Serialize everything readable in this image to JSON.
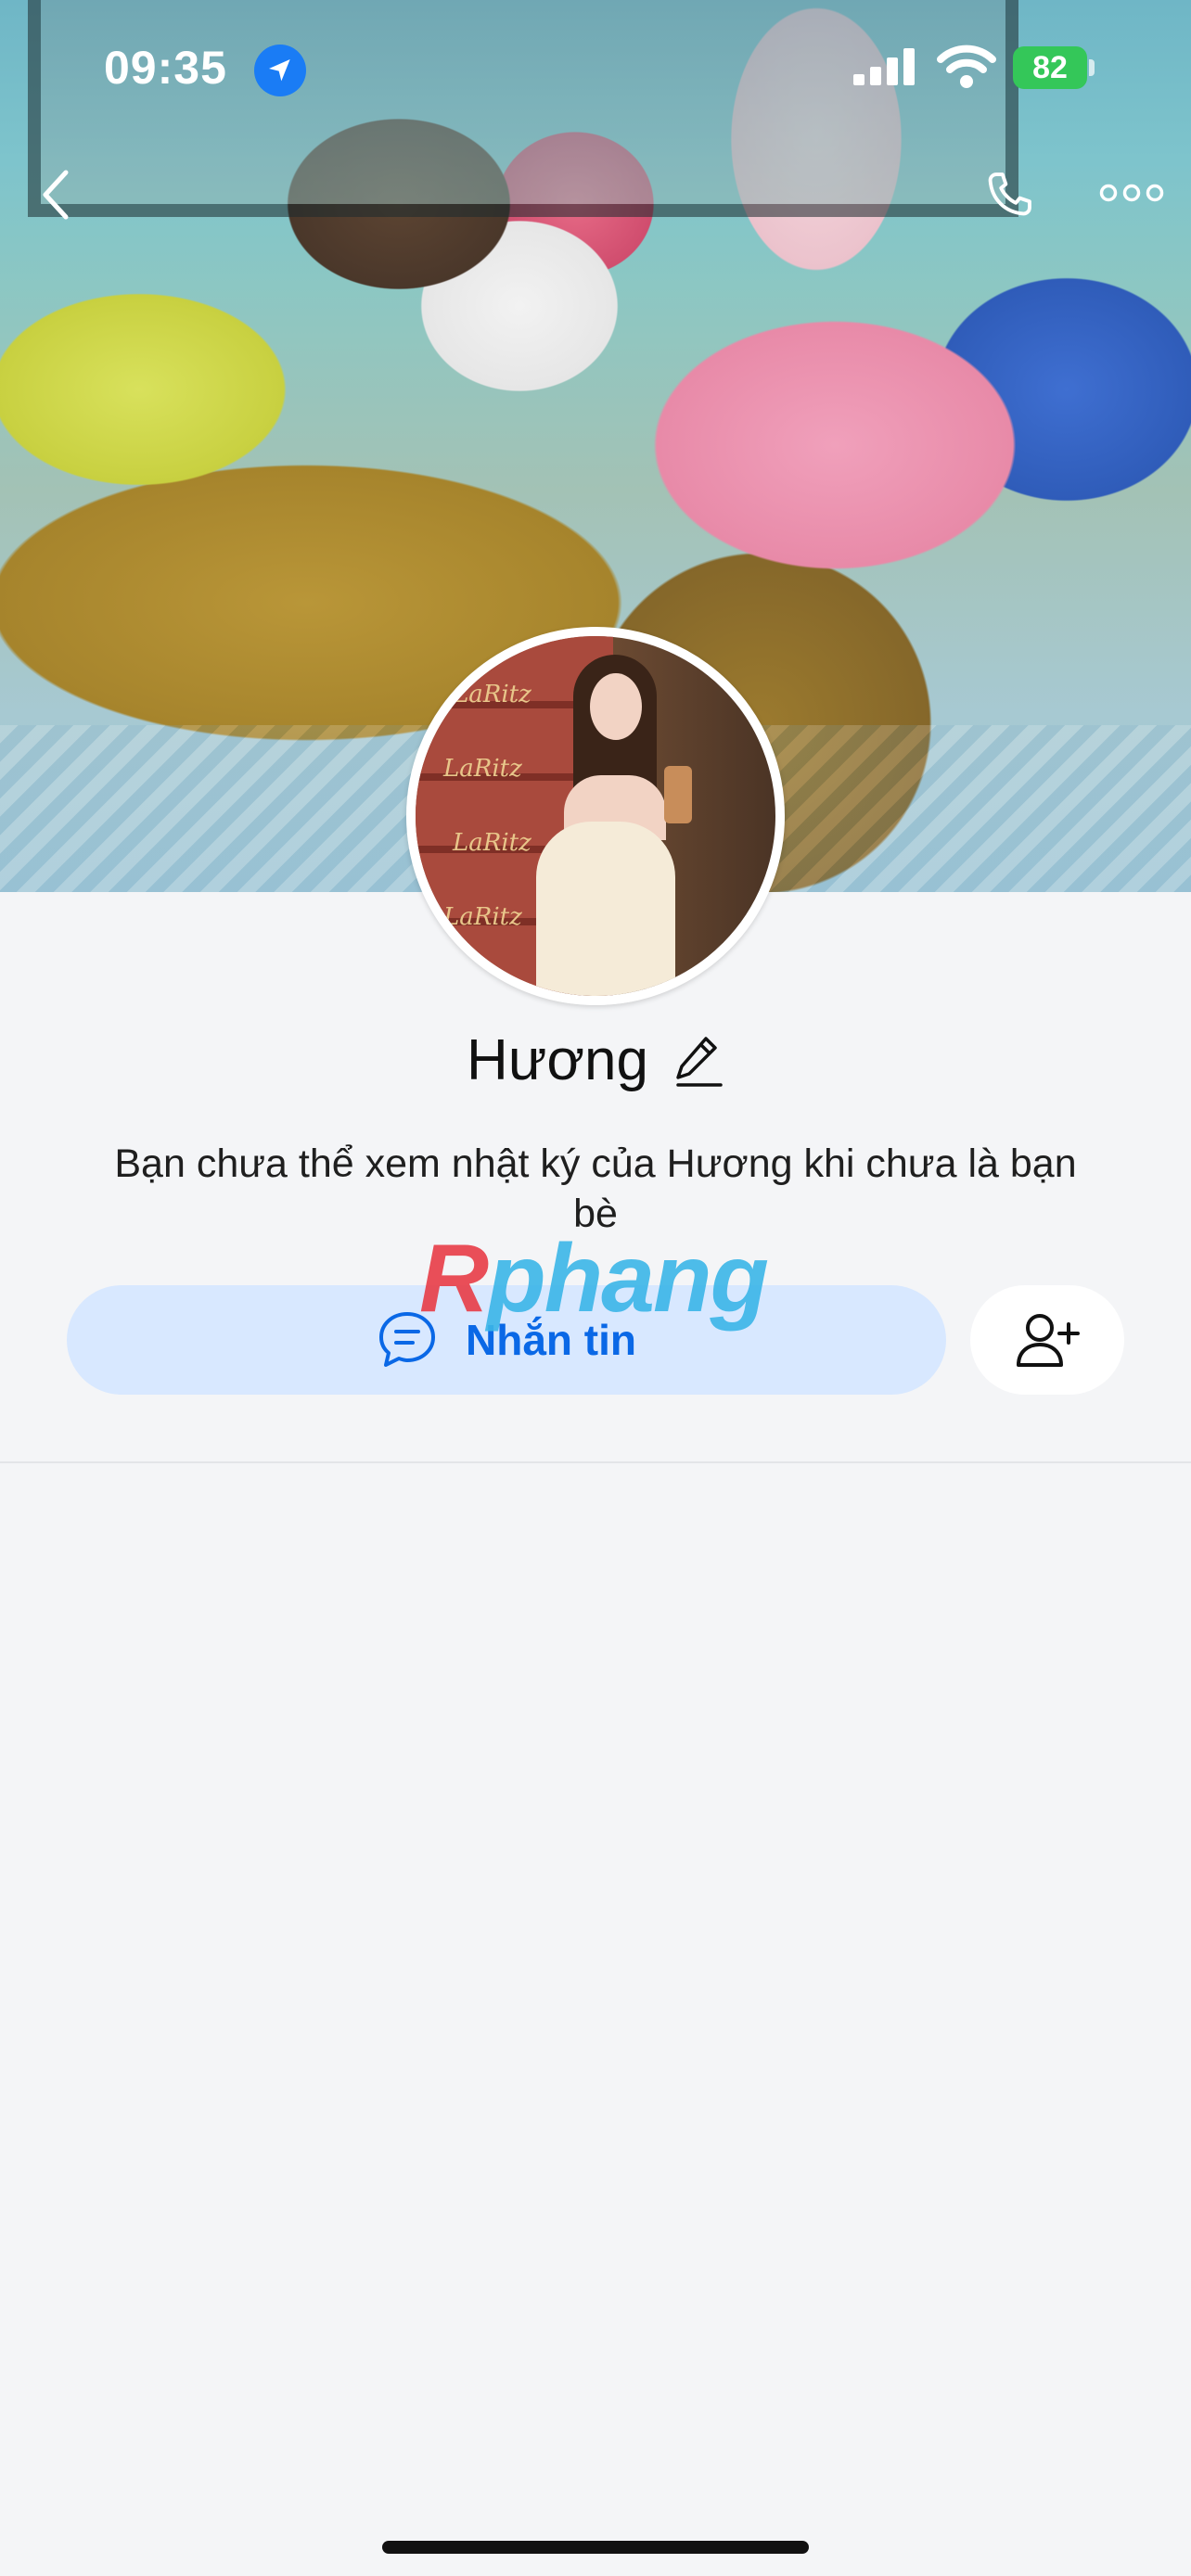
{
  "status_bar": {
    "time": "09:35",
    "battery": "82",
    "icons": [
      "location-arrow-icon",
      "signal-icon",
      "wifi-icon",
      "battery-icon"
    ]
  },
  "nav": {
    "icons": [
      "chevron-left-icon",
      "phone-icon",
      "more-horizontal-icon"
    ]
  },
  "cover": {
    "avatar_box_text": "LaRitz"
  },
  "profile": {
    "name": "Hương",
    "notice": "Bạn chưa thể xem nhật ký của Hương khi chưa là bạn bè"
  },
  "actions": {
    "message_label": "Nhắn tin",
    "message_icon": "chat-bubble-icon",
    "add_friend_icon": "user-plus-icon"
  },
  "watermark": {
    "first": "R",
    "rest": "phang"
  },
  "colors": {
    "accent": "#0a68e6",
    "message_button_bg": "#d8e8ff",
    "battery": "#34c759",
    "page_bg": "#f4f5f7"
  }
}
